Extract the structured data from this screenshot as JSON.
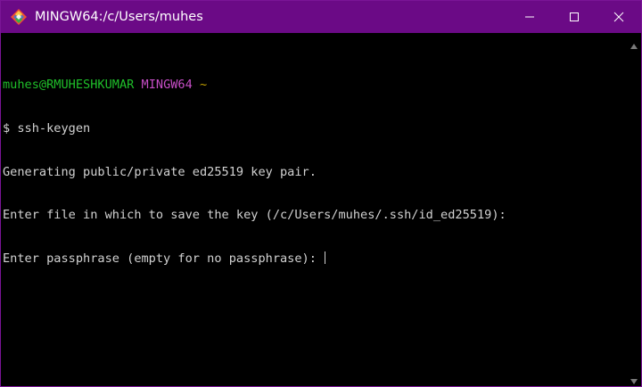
{
  "window": {
    "title": "MINGW64:/c/Users/muhes",
    "app_icon": "git-bash-icon"
  },
  "controls": {
    "minimize_icon": "minimize-icon",
    "maximize_icon": "maximize-icon",
    "close_icon": "close-icon"
  },
  "terminal": {
    "prompt_user": "muhes@RMUHESHKUMAR",
    "prompt_system": "MINGW64",
    "prompt_path": "~",
    "lines": [
      "$ ssh-keygen",
      "Generating public/private ed25519 key pair.",
      "Enter file in which to save the key (/c/Users/muhes/.ssh/id_ed25519):",
      "Enter passphrase (empty for no passphrase): "
    ]
  },
  "colors": {
    "titlebar": "#6b0a86",
    "background": "#000000",
    "text": "#d2d2d2",
    "prompt_user": "#1fbf2a",
    "prompt_system": "#c74ec7",
    "prompt_path": "#c2a000"
  }
}
